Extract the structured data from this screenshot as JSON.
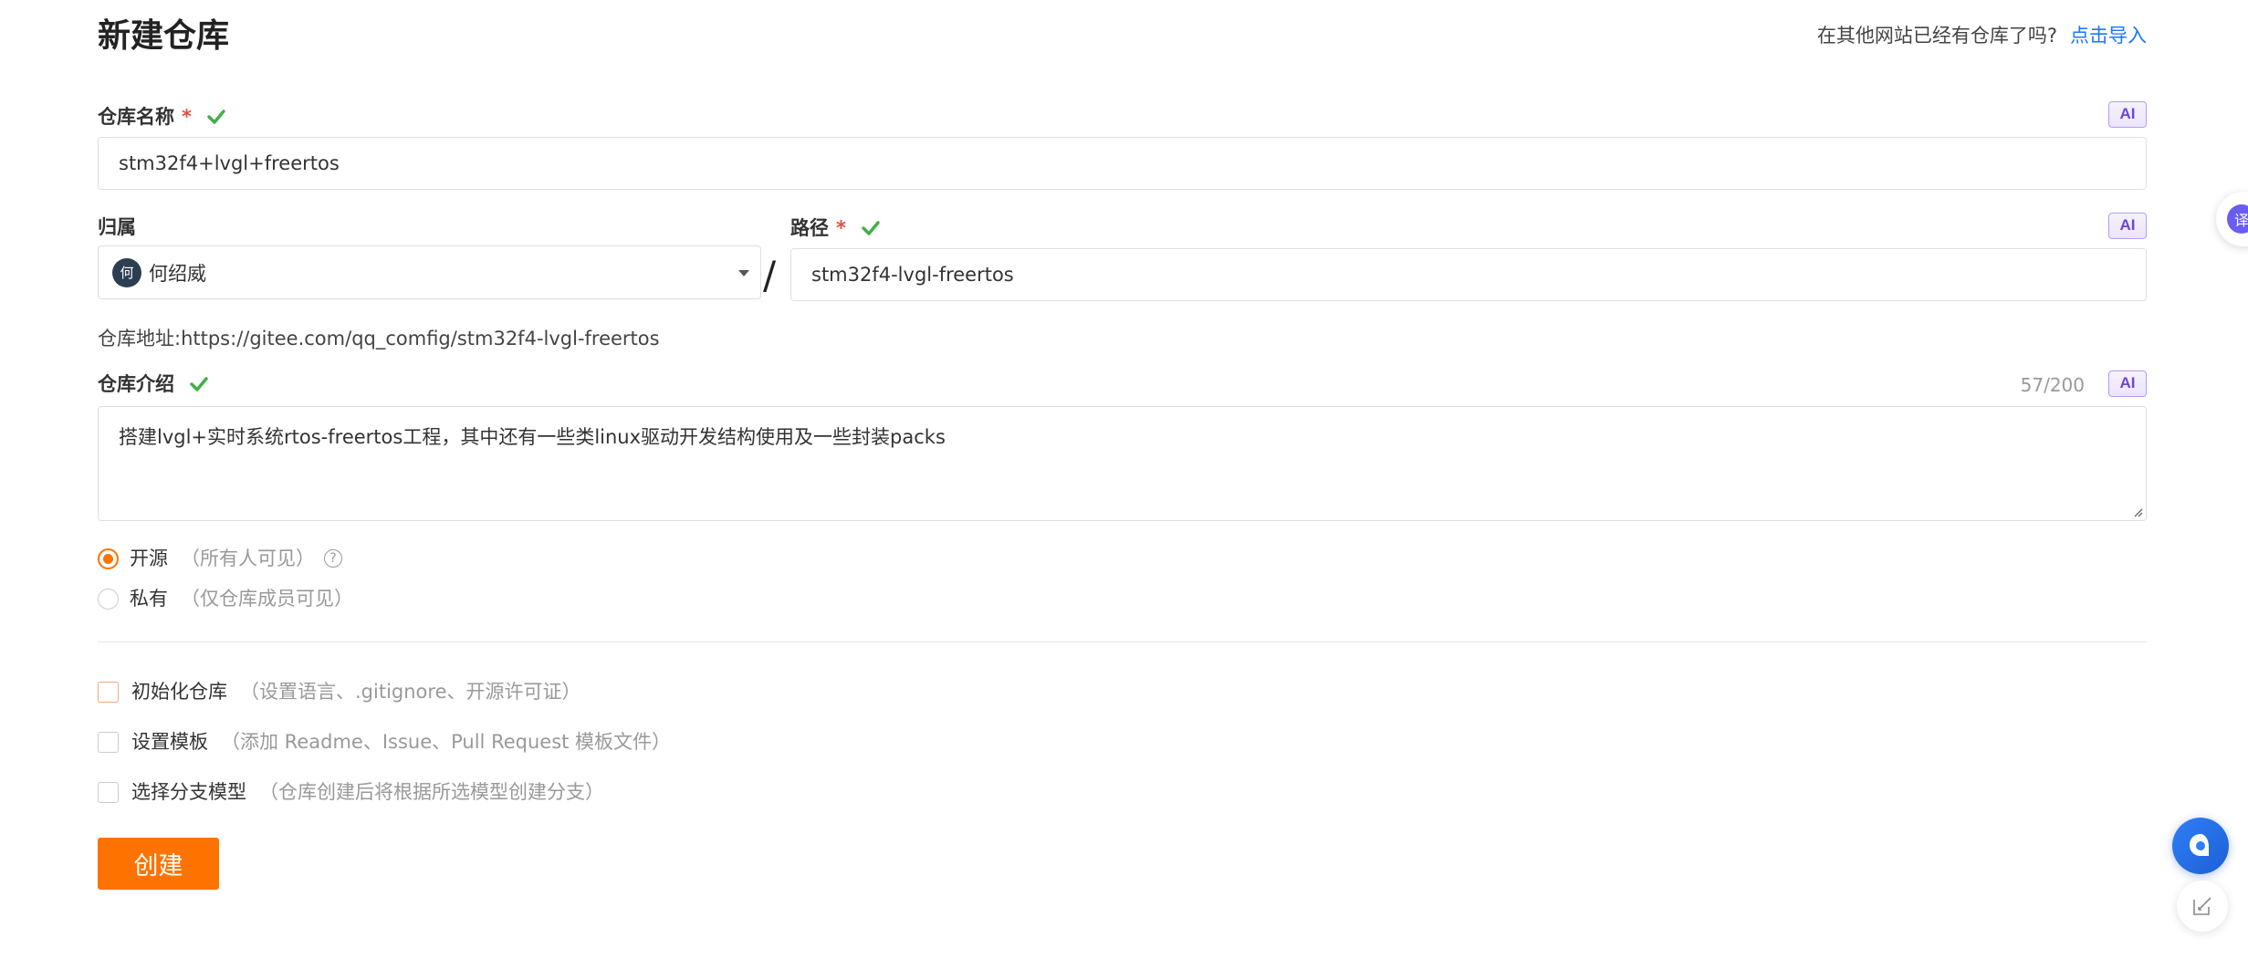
{
  "page": {
    "title": "新建仓库",
    "import_hint": "在其他网站已经有仓库了吗?",
    "import_link": "点击导入"
  },
  "ai_badge": "AI",
  "repo_name": {
    "label": "仓库名称",
    "required_mark": "*",
    "value": "stm32f4+lvgl+freertos"
  },
  "owner": {
    "label": "归属",
    "avatar_text": "何",
    "value": "何绍威"
  },
  "path": {
    "label": "路径",
    "required_mark": "*",
    "separator": "/",
    "value": "stm32f4-lvgl-freertos"
  },
  "repo_url": "仓库地址:https://gitee.com/qq_comfig/stm32f4-lvgl-freertos",
  "description": {
    "label": "仓库介绍",
    "counter": "57/200",
    "value": "搭建lvgl+实时系统rtos-freertos工程，其中还有一些类linux驱动开发结构使用及一些封装packs"
  },
  "visibility": {
    "options": [
      {
        "label": "开源",
        "hint": "（所有人可见）",
        "selected": true
      },
      {
        "label": "私有",
        "hint": "（仅仓库成员可见）",
        "selected": false
      }
    ],
    "help_glyph": "?"
  },
  "options": [
    {
      "label": "初始化仓库",
      "hint": "（设置语言、.gitignore、开源许可证）",
      "checked": false
    },
    {
      "label": "设置模板",
      "hint": "（添加 Readme、Issue、Pull Request 模板文件）",
      "checked": false
    },
    {
      "label": "选择分支模型",
      "hint": "（仓库创建后将根据所选模型创建分支）",
      "checked": false
    }
  ],
  "create_button": "创建",
  "translate_tab_glyph": "译",
  "colors": {
    "accent": "#fe7300",
    "link": "#1677ff",
    "success": "#3cb043",
    "required": "#e74c3c",
    "ai": "#6b46d8"
  }
}
